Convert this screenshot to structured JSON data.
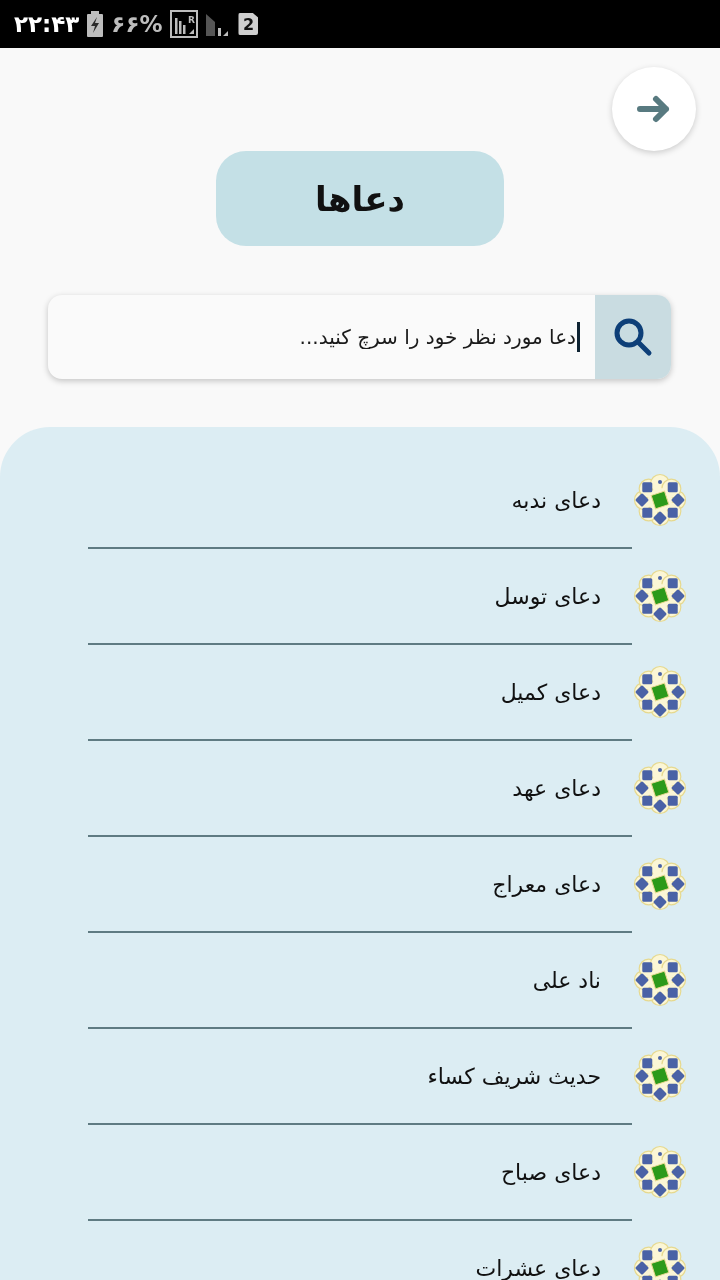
{
  "status_bar": {
    "time": "۲۲:۴۳",
    "charging": true,
    "battery": "۶۶%",
    "network_badge": "R",
    "sim": "2"
  },
  "header": {
    "title": "دعاها"
  },
  "search": {
    "placeholder": "دعا مورد نظر خود را سرچ کنید...",
    "focused": true
  },
  "items": [
    {
      "label": "دعای ندبه"
    },
    {
      "label": "دعای توسل"
    },
    {
      "label": "دعای کمیل"
    },
    {
      "label": "دعای عهد"
    },
    {
      "label": "دعای معراج"
    },
    {
      "label": "ناد علی"
    },
    {
      "label": "حدیث شریف کساء"
    },
    {
      "label": "دعای صباح"
    },
    {
      "label": "دعای عشرات"
    }
  ]
}
